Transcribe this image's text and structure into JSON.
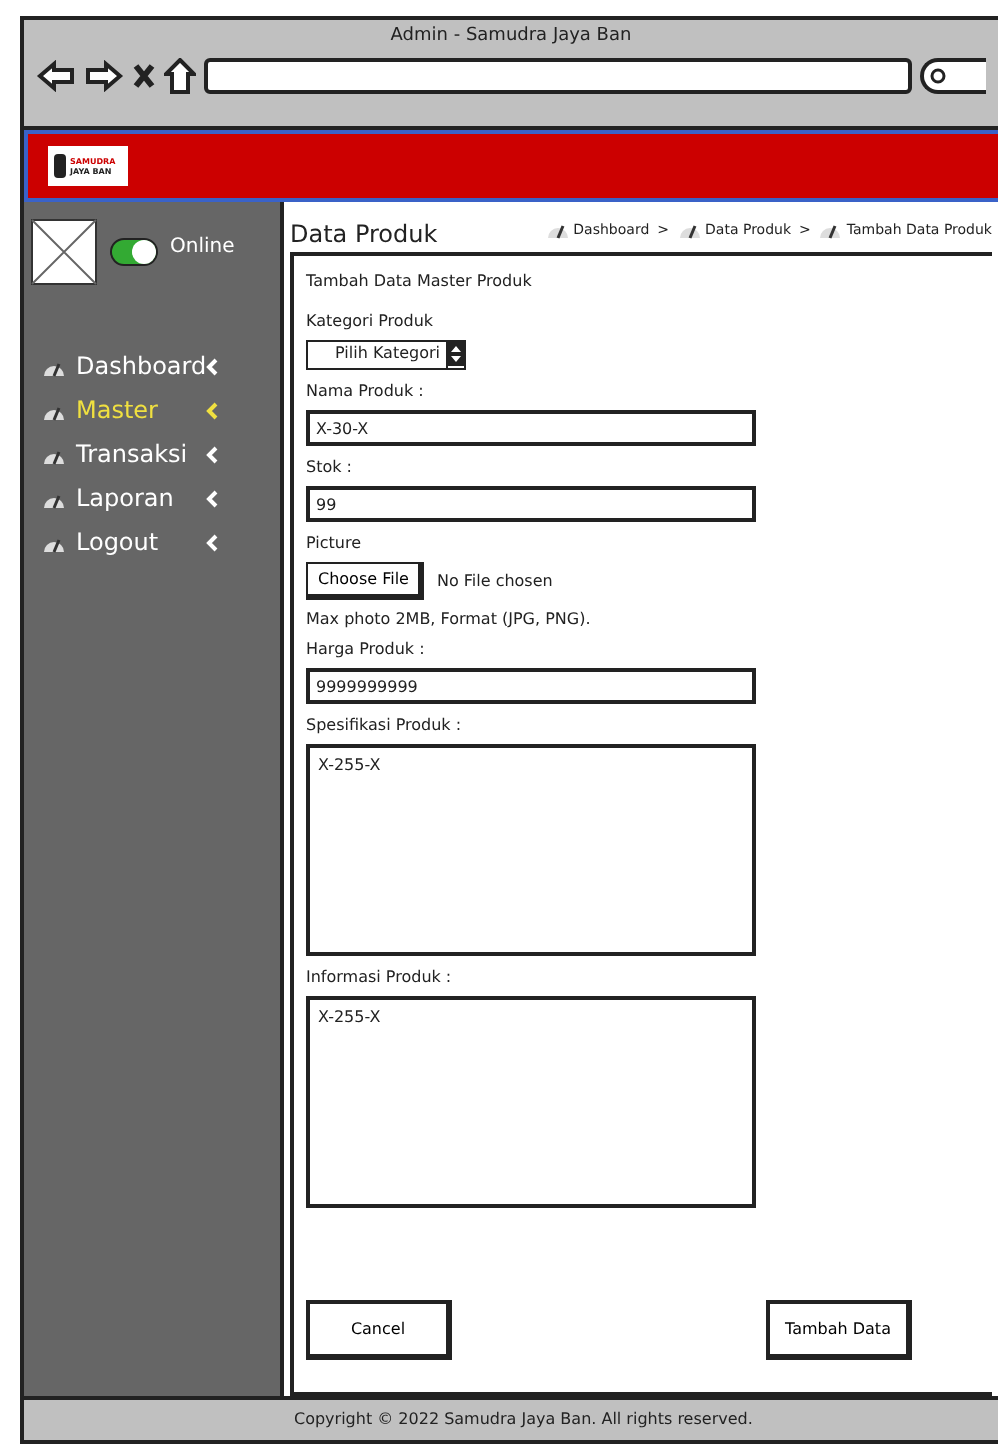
{
  "window": {
    "title": "Admin - Samudra Jaya Ban"
  },
  "logo": {
    "line_1": "SAMUDRA",
    "line_2": "JAYA BAN"
  },
  "user": {
    "status": "Online",
    "online": true
  },
  "sidebar": {
    "items": [
      {
        "label": "Dashboard",
        "selected": false
      },
      {
        "label": "Master",
        "selected": true
      },
      {
        "label": "Transaksi",
        "selected": false
      },
      {
        "label": "Laporan",
        "selected": false
      },
      {
        "label": "Logout",
        "selected": false
      }
    ]
  },
  "page": {
    "title": "Data Produk",
    "breadcrumbs": [
      {
        "label": "Dashboard"
      },
      {
        "label": "Data Produk"
      },
      {
        "label": "Tambah Data Produk"
      }
    ],
    "separator": ">"
  },
  "form": {
    "title": "Tambah Data Master Produk",
    "fields": [
      {
        "kind": "select",
        "label": "Kategori Produk",
        "value": "Pilih Kategori"
      },
      {
        "kind": "input",
        "label": "Nama Produk :",
        "value": "X-30-X"
      },
      {
        "kind": "input",
        "label": "Stok :",
        "value": "99"
      },
      {
        "kind": "file",
        "label": "Picture",
        "button": "Choose File",
        "status": "No File chosen",
        "hint": "Max photo 2MB, Format (JPG, PNG)."
      },
      {
        "kind": "input",
        "label": "Harga Produk :",
        "value": "9999999999"
      },
      {
        "kind": "textarea",
        "label": "Spesifikasi Produk :",
        "value": "X-255-X"
      },
      {
        "kind": "textarea",
        "label": "Informasi Produk :",
        "value": "X-255-X"
      }
    ],
    "buttons": [
      "Cancel",
      "Tambah Data"
    ]
  },
  "footer": "Copyright © 2022 Samudra Jaya Ban. All rights reserved."
}
